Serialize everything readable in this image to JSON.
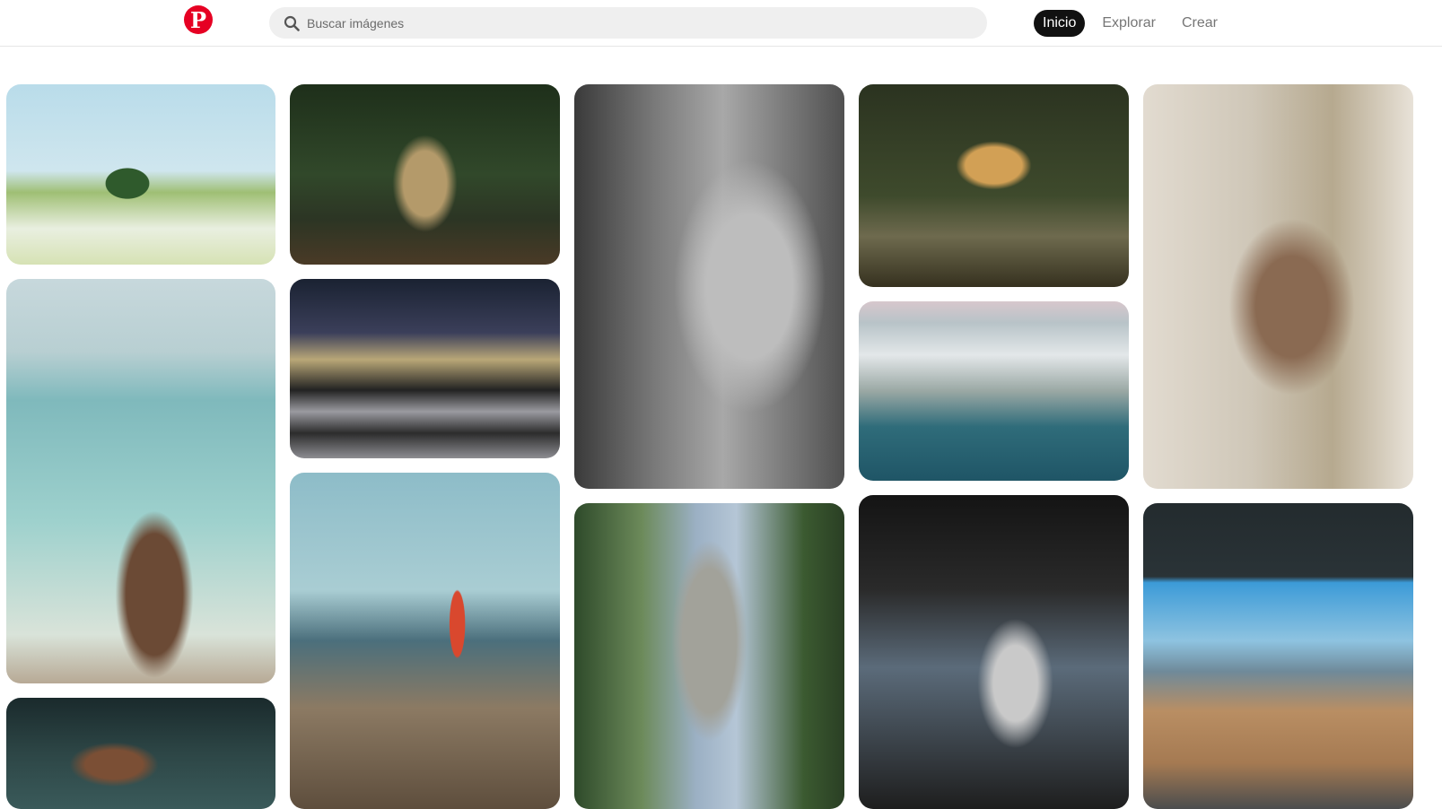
{
  "header": {
    "logo_letter": "P",
    "search": {
      "placeholder": "Buscar imágenes",
      "value": ""
    },
    "nav": [
      {
        "label": "Inicio",
        "active": true
      },
      {
        "label": "Explorar",
        "active": false
      },
      {
        "label": "Crear",
        "active": false
      }
    ]
  },
  "colors": {
    "brand": "#e60023",
    "nav_active_bg": "#111111",
    "search_bg": "#efefef",
    "nav_text": "#767676"
  },
  "icons": [
    "pinterest-logo-icon",
    "search-icon"
  ],
  "feed": {
    "pins": [
      {
        "subject": "field-flowers"
      },
      {
        "subject": "forest-two-men"
      },
      {
        "subject": "bw-woman-mirror"
      },
      {
        "subject": "nuthatch-bird"
      },
      {
        "subject": "man-flowers-kitchen"
      },
      {
        "subject": "beach-woman-boats"
      },
      {
        "subject": "city-taxi-motion"
      },
      {
        "subject": "snowy-lake-aerial"
      },
      {
        "subject": "lighthouse-rocks"
      },
      {
        "subject": "trees-mountain"
      },
      {
        "subject": "train-travelers"
      },
      {
        "subject": "desert-car-window"
      },
      {
        "subject": "hands-closeup"
      }
    ]
  }
}
